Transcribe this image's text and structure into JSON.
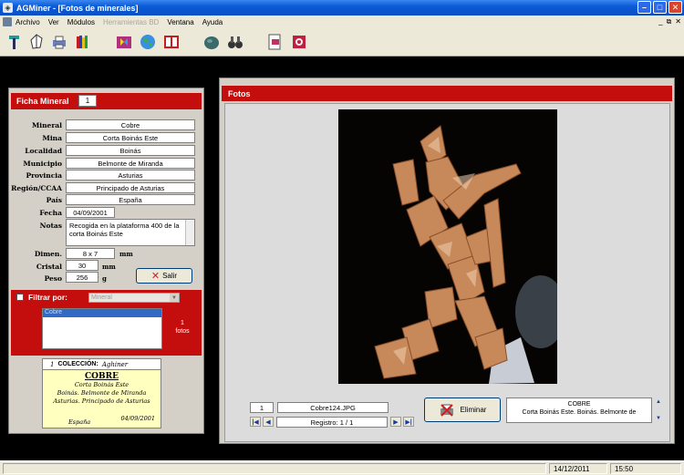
{
  "window": {
    "title": "AGMiner - [Fotos de minerales]",
    "app_icon": "app-icon"
  },
  "menu": {
    "items": [
      {
        "label": "Archivo",
        "enabled": true
      },
      {
        "label": "Ver",
        "enabled": true
      },
      {
        "label": "Módulos",
        "enabled": true
      },
      {
        "label": "Herramientas BD",
        "enabled": false
      },
      {
        "label": "Ventana",
        "enabled": true
      },
      {
        "label": "Ayuda",
        "enabled": true
      }
    ]
  },
  "toolbar": {
    "icons": [
      "tool-pick-icon",
      "mineral-crystal-icon",
      "printer-icon",
      "library-books-icon",
      "butterfly-book-icon",
      "globe-icon",
      "open-book-icon",
      "rock-icon",
      "binoculars-icon",
      "photo-document-icon",
      "record-icon"
    ]
  },
  "ficha": {
    "title": "Ficha Mineral",
    "record_number": "1",
    "fields": {
      "mineral": {
        "label": "Mineral",
        "value": "Cobre"
      },
      "mina": {
        "label": "Mina",
        "value": "Corta Boinás Este"
      },
      "localidad": {
        "label": "Localidad",
        "value": "Boinás"
      },
      "municipio": {
        "label": "Municipio",
        "value": "Belmonte de Miranda"
      },
      "provincia": {
        "label": "Provincia",
        "value": "Asturias"
      },
      "region": {
        "label": "Región/CCAA",
        "value": "Principado de Asturias"
      },
      "pais": {
        "label": "País",
        "value": "España"
      },
      "fecha": {
        "label": "Fecha",
        "value": "04/09/2001"
      },
      "notas": {
        "label": "Notas",
        "value": "Recogida en la plataforma 400 de la corta Boinás Este"
      },
      "dimen": {
        "label": "Dimen.",
        "value": "8 x 7",
        "unit": "mm"
      },
      "cristal": {
        "label": "Cristal",
        "value": "30",
        "unit": "mm"
      },
      "peso": {
        "label": "Peso",
        "value": "256",
        "unit": "g"
      }
    },
    "salir_label": "Salir"
  },
  "filter": {
    "label": "Filtrar por:",
    "selected": "Mineral",
    "list_items": [
      "Cobre"
    ],
    "count_number": "1",
    "count_label": "fotos"
  },
  "card": {
    "number": "1",
    "collection_label": "COLECCIÓN:",
    "collection_name": "Aghiner",
    "mineral": "COBRE",
    "line1": "Corta Boinás Este",
    "line2": "Boinás. Belmonte de Miranda",
    "line3": "Asturias. Principado de Asturias",
    "country": "España",
    "date": "04/09/2001"
  },
  "fotos": {
    "title": "Fotos",
    "photo_number": "1",
    "filename": "Cobre124.JPG",
    "record_label": "Registro: 1 / 1",
    "eliminar_label": "Eliminar",
    "desc_title": "COBRE",
    "desc_text": "Corta Boinás Este. Boinás. Belmonte de"
  },
  "status": {
    "date": "14/12/2011",
    "time": "15:50"
  }
}
